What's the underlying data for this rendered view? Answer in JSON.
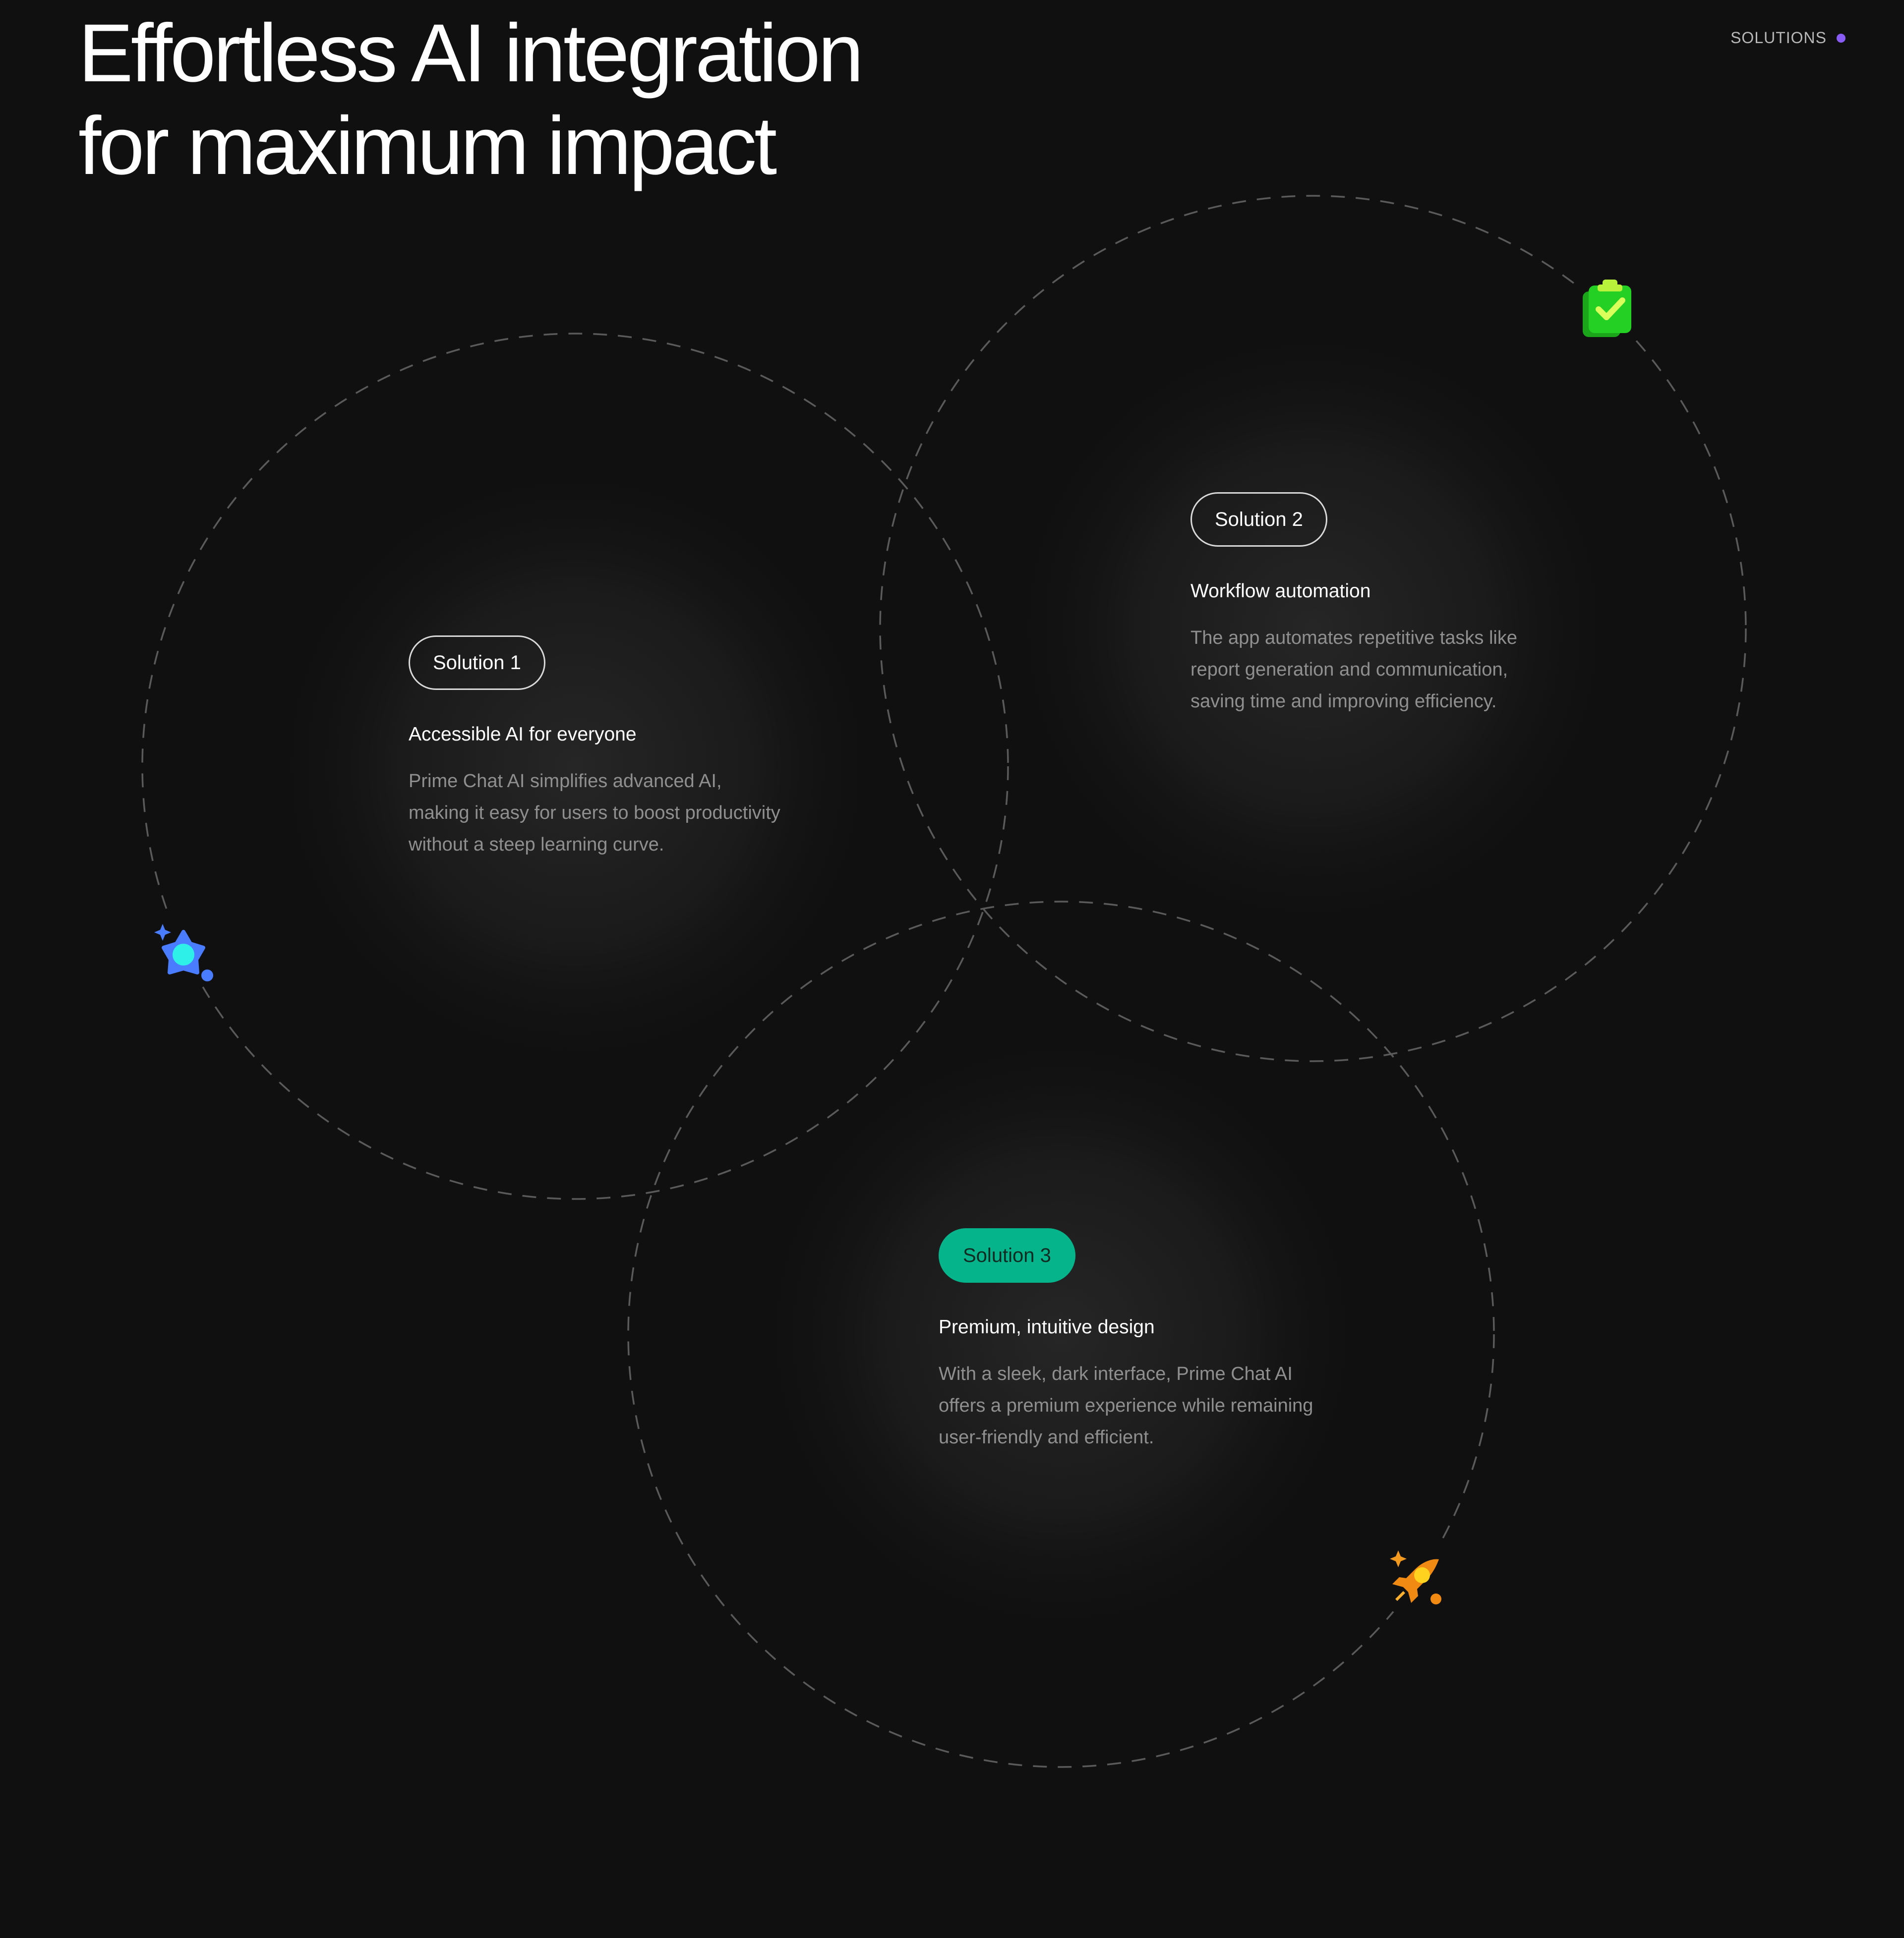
{
  "header": {
    "title_line1": "Effortless AI integration",
    "title_line2": "for maximum impact",
    "section_label": "SOLUTIONS"
  },
  "solutions": [
    {
      "label": "Solution 1",
      "title": "Accessible AI for everyone",
      "description_lines": [
        "Prime Chat AI simplifies advanced AI,",
        "making it easy for users to boost productivity",
        "without a steep learning curve."
      ],
      "icon": "star-badge-icon",
      "active": false
    },
    {
      "label": "Solution 2",
      "title": "Workflow automation",
      "description_lines": [
        "The app automates repetitive tasks like",
        "report generation and communication,",
        "saving time and improving efficiency."
      ],
      "icon": "clipboard-check-icon",
      "active": false
    },
    {
      "label": "Solution 3",
      "title": "Premium, intuitive design",
      "description_lines": [
        "With a sleek, dark interface, Prime Chat AI",
        "offers a premium experience while remaining",
        "user-friendly and efficient."
      ],
      "icon": "rocket-icon",
      "active": true
    }
  ],
  "colors": {
    "background": "#101010",
    "accent_green": "#05b48a",
    "label_dot": "#8a5cf6",
    "muted_text": "#8f8f8f"
  }
}
